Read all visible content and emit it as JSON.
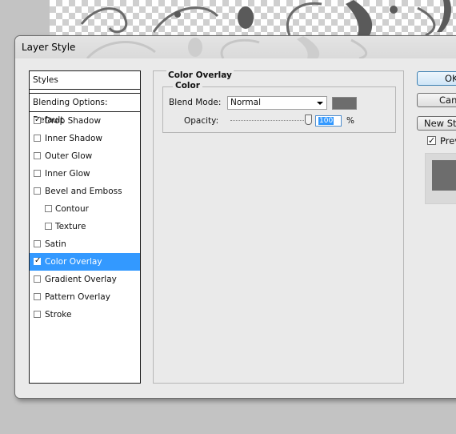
{
  "window": {
    "title": "Layer Style"
  },
  "styles_list": {
    "header": "Styles",
    "blending_options": "Blending Options: Default",
    "items": [
      {
        "label": "Drop Shadow",
        "checked": true,
        "selected": false,
        "sub": false
      },
      {
        "label": "Inner Shadow",
        "checked": false,
        "selected": false,
        "sub": false
      },
      {
        "label": "Outer Glow",
        "checked": false,
        "selected": false,
        "sub": false
      },
      {
        "label": "Inner Glow",
        "checked": false,
        "selected": false,
        "sub": false
      },
      {
        "label": "Bevel and Emboss",
        "checked": false,
        "selected": false,
        "sub": false
      },
      {
        "label": "Contour",
        "checked": false,
        "selected": false,
        "sub": true
      },
      {
        "label": "Texture",
        "checked": false,
        "selected": false,
        "sub": true
      },
      {
        "label": "Satin",
        "checked": false,
        "selected": false,
        "sub": false
      },
      {
        "label": "Color Overlay",
        "checked": true,
        "selected": true,
        "sub": false
      },
      {
        "label": "Gradient Overlay",
        "checked": false,
        "selected": false,
        "sub": false
      },
      {
        "label": "Pattern Overlay",
        "checked": false,
        "selected": false,
        "sub": false
      },
      {
        "label": "Stroke",
        "checked": false,
        "selected": false,
        "sub": false
      }
    ]
  },
  "panel": {
    "title": "Color Overlay",
    "group_title": "Color",
    "blend_mode_label": "Blend Mode:",
    "blend_mode_value": "Normal",
    "overlay_color": "#6d6d6d",
    "opacity_label": "Opacity:",
    "opacity_value": "100",
    "opacity_unit": "%"
  },
  "buttons": {
    "ok": "OK",
    "cancel": "Cancel",
    "new_style": "New Style...",
    "preview_label": "Preview",
    "preview_checked": true
  },
  "colors": {
    "selection": "#3399ff",
    "dialog_bg": "#eaeaea",
    "backdrop": "#c3c3c3"
  }
}
